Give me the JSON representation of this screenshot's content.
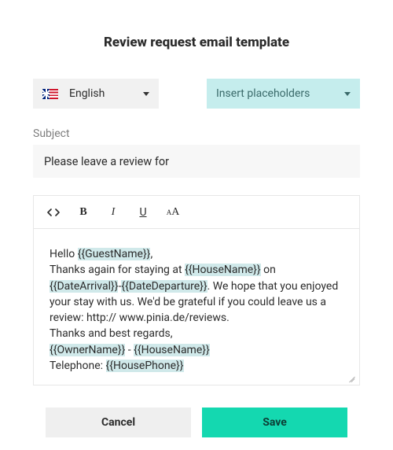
{
  "title": "Review request email template",
  "language": {
    "label": "English"
  },
  "placeholders": {
    "label": "Insert placeholders"
  },
  "subject": {
    "label": "Subject",
    "value": "Please leave a review for"
  },
  "toolbar": {
    "code": "code-icon",
    "bold": "B",
    "italic": "I",
    "underline": "U",
    "fontsize": "font-size-icon"
  },
  "body": {
    "hello_prefix": "Hello ",
    "hello_ph": "{{GuestName}}",
    "hello_suffix": ",",
    "thanks_prefix": "Thanks again for staying at ",
    "house_ph": "{{HouseName}}",
    "on": " on ",
    "arrival_ph": "{{DateArrival}}",
    "dash": "-",
    "departure_ph": "{{DateDeparture}}",
    "rest1": ". We hope that you enjoyed your stay with us. We'd be grateful if you could leave us a review: http://",
    "rest2": "www.pinia.de/reviews.",
    "regards": "Thanks and best regards,",
    "owner_ph": "{{OwnerName}}",
    "sep": " - ",
    "house2_ph": "{{HouseName}}",
    "tel_label": "Telephone: ",
    "phone_ph": "{{HousePhone}}"
  },
  "buttons": {
    "cancel": "Cancel",
    "save": "Save"
  }
}
